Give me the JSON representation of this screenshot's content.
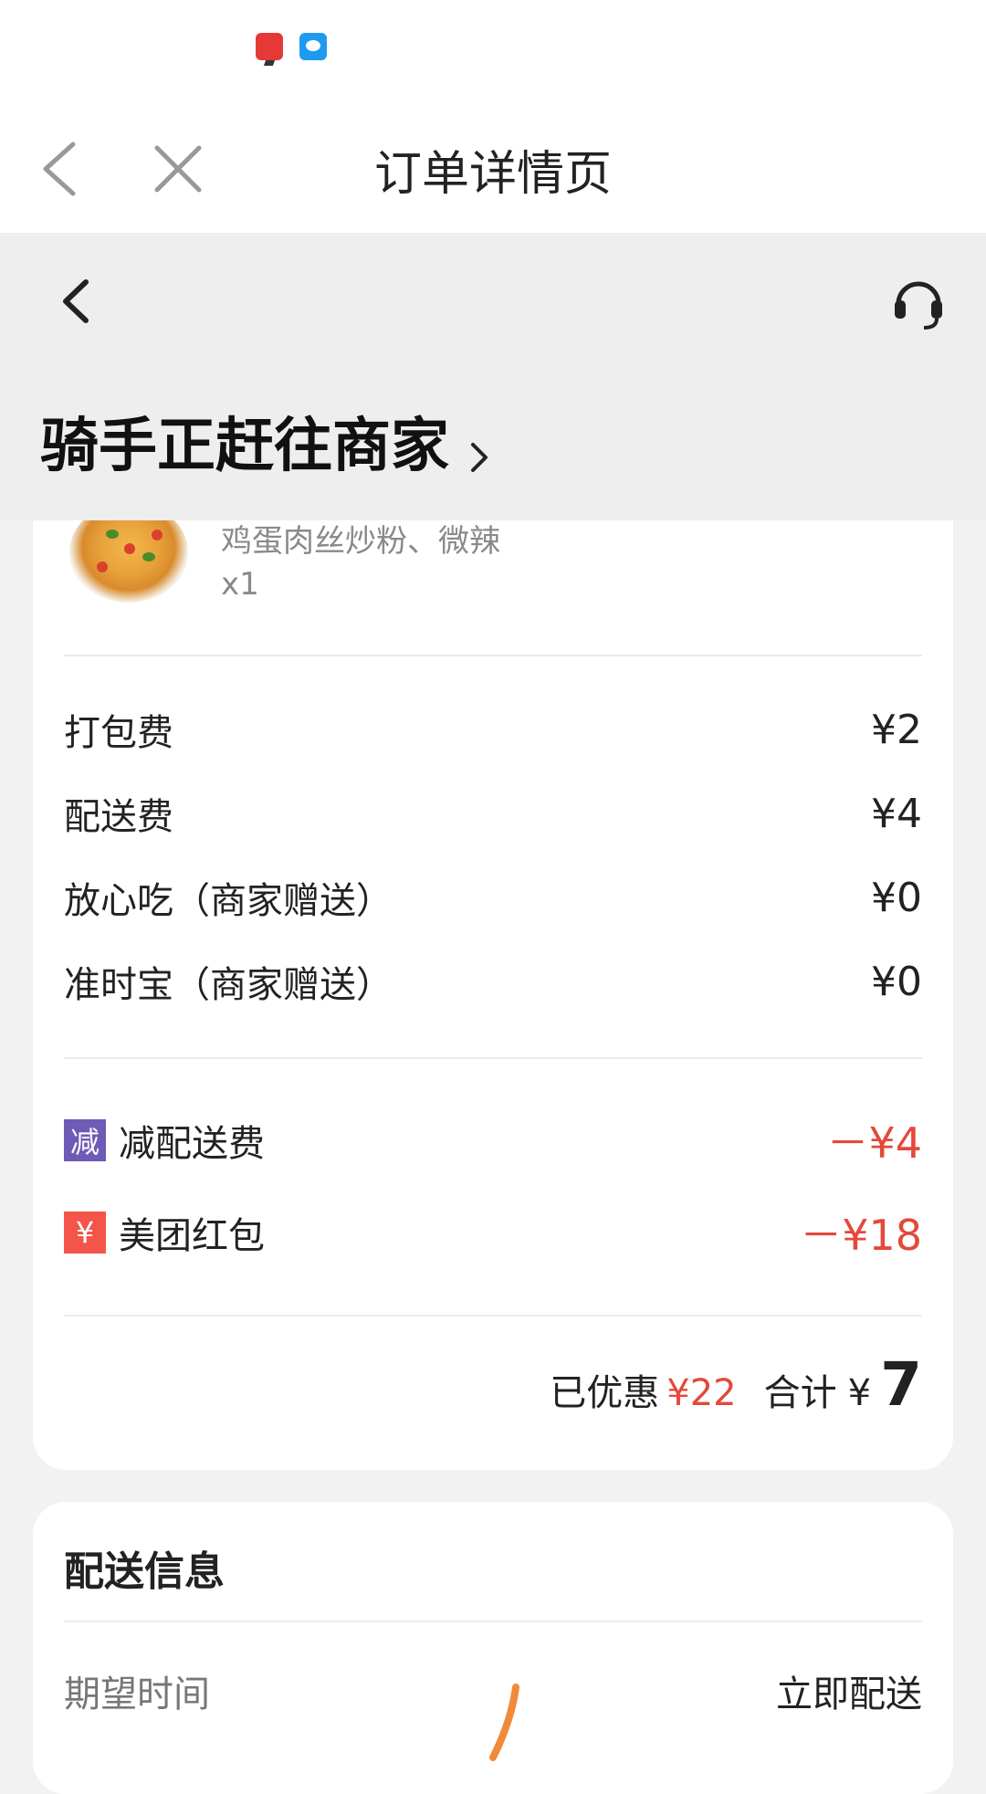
{
  "titlebar": {
    "title": "订单详情页"
  },
  "header": {
    "status": "骑手正赶往商家"
  },
  "order": {
    "dish_spec": "鸡蛋肉丝炒粉、微辣",
    "dish_qty": "x1",
    "fees": [
      {
        "label": "打包费",
        "value": "¥2"
      },
      {
        "label": "配送费",
        "value": "¥4"
      },
      {
        "label": "放心吃（商家赠送）",
        "value": "¥0"
      },
      {
        "label": "准时宝（商家赠送）",
        "value": "¥0"
      }
    ],
    "discounts": [
      {
        "badge": "减",
        "label": "减配送费",
        "value": "－¥4"
      },
      {
        "badge": "¥",
        "label": "美团红包",
        "value": "－¥18"
      }
    ],
    "saved_label": "已优惠",
    "saved_value": "¥22",
    "total_label": "合计",
    "total_currency": "¥",
    "total_value": "7"
  },
  "delivery": {
    "section_title": "配送信息",
    "expected_time_label": "期望时间",
    "expected_time_value": "立即配送"
  },
  "colors": {
    "accent_red": "#e4483a",
    "purple_badge": "#6e5bb5",
    "red_badge": "#f3554a"
  }
}
